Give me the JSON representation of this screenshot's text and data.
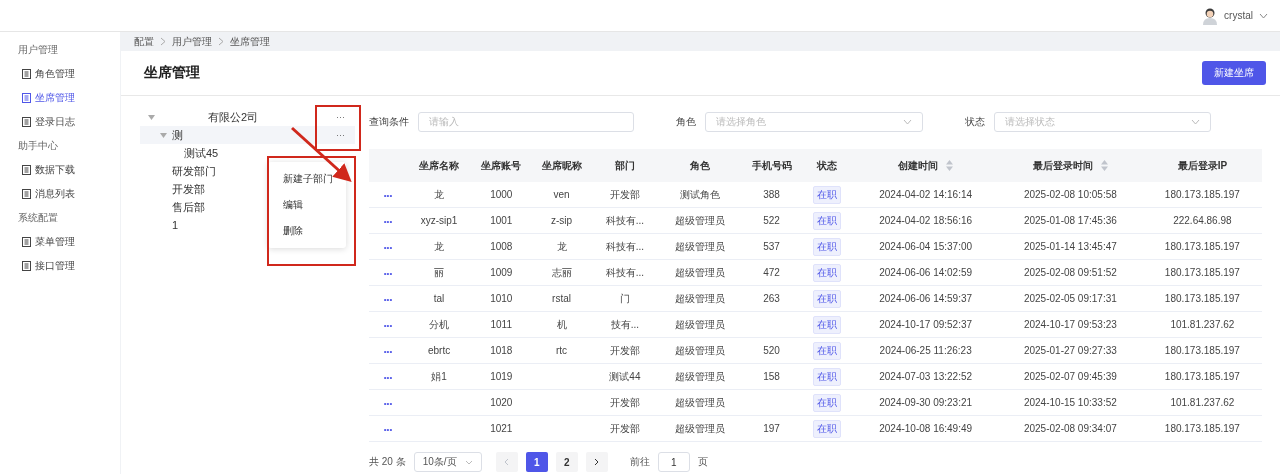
{
  "header": {
    "user": "crystal"
  },
  "sidebar": [
    {
      "group": "用户管理",
      "items": [
        {
          "label": "角色管理",
          "selected": false
        },
        {
          "label": "坐席管理",
          "selected": true
        },
        {
          "label": "登录日志",
          "selected": false
        }
      ]
    },
    {
      "group": "助手中心",
      "items": [
        {
          "label": "数据下载",
          "selected": false
        },
        {
          "label": "消息列表",
          "selected": false
        }
      ]
    },
    {
      "group": "系统配置",
      "items": [
        {
          "label": "菜单管理",
          "selected": false
        },
        {
          "label": "接口管理",
          "selected": false
        }
      ]
    }
  ],
  "breadcrumb": [
    "配置",
    "用户管理",
    "坐席管理"
  ],
  "page_title": "坐席管理",
  "new_button": "新建坐席",
  "tree": [
    {
      "label": "有限公2司",
      "expanded": true,
      "selected": false,
      "more": "···",
      "children": [
        {
          "label": "测",
          "expanded": true,
          "selected": true,
          "more": "···",
          "children": [
            {
              "label": "测试45",
              "selected": false
            }
          ]
        },
        {
          "label": "研发部门",
          "selected": false
        },
        {
          "label": "开发部",
          "selected": false
        },
        {
          "label": "售后部",
          "selected": false
        },
        {
          "label": "1",
          "selected": false
        }
      ]
    }
  ],
  "context_menu": [
    "新建子部门",
    "编辑",
    "删除"
  ],
  "filters": [
    {
      "label": "查询条件",
      "kind": "input",
      "placeholder": "请输入"
    },
    {
      "label": "角色",
      "kind": "select",
      "placeholder": "请选择角色"
    },
    {
      "label": "状态",
      "kind": "select",
      "placeholder": "请选择状态"
    }
  ],
  "table": {
    "columns": [
      {
        "label": "坐席名称",
        "sortable": false
      },
      {
        "label": "坐席账号",
        "sortable": false
      },
      {
        "label": "坐席昵称",
        "sortable": false
      },
      {
        "label": "部门",
        "sortable": false
      },
      {
        "label": "角色",
        "sortable": false
      },
      {
        "label": "手机号码",
        "sortable": false
      },
      {
        "label": "状态",
        "sortable": false
      },
      {
        "label": "创建时间",
        "sortable": true
      },
      {
        "label": "最后登录时间",
        "sortable": true
      },
      {
        "label": "最后登录IP",
        "sortable": false
      }
    ],
    "rows": [
      {
        "action": "•••",
        "cells": [
          "龙",
          "1000",
          "ven",
          "开发部",
          "测试角色",
          "388",
          "在职",
          "2024-04-02 14:16:14",
          "2025-02-08 10:05:58",
          "180.173.185.197"
        ]
      },
      {
        "action": "•••",
        "cells": [
          "xyz-sip1",
          "1001",
          "z-sip",
          "科技有...",
          "超级管理员",
          "522",
          "在职",
          "2024-04-02 18:56:16",
          "2025-01-08 17:45:36",
          "222.64.86.98"
        ]
      },
      {
        "action": "•••",
        "cells": [
          "龙",
          "1008",
          "龙",
          "科技有...",
          "超级管理员",
          "537",
          "在职",
          "2024-06-04 15:37:00",
          "2025-01-14 13:45:47",
          "180.173.185.197"
        ]
      },
      {
        "action": "•••",
        "cells": [
          "丽",
          "1009",
          "志丽",
          "科技有...",
          "超级管理员",
          "472",
          "在职",
          "2024-06-06 14:02:59",
          "2025-02-08 09:51:52",
          "180.173.185.197"
        ]
      },
      {
        "action": "•••",
        "cells": [
          "tal",
          "1010",
          "rstal",
          "门",
          "超级管理员",
          "263",
          "在职",
          "2024-06-06 14:59:37",
          "2025-02-05 09:17:31",
          "180.173.185.197"
        ]
      },
      {
        "action": "•••",
        "cells": [
          "分机",
          "1011",
          "机",
          "技有...",
          "超级管理员",
          null,
          "在职",
          "2024-10-17 09:52:37",
          "2024-10-17 09:53:23",
          "101.81.237.62"
        ]
      },
      {
        "action": "•••",
        "cells": [
          "ebrtc",
          "1018",
          "rtc",
          "开发部",
          "超级管理员",
          "520",
          "在职",
          "2024-06-25 11:26:23",
          "2025-01-27 09:27:33",
          "180.173.185.197"
        ]
      },
      {
        "action": "•••",
        "cells": [
          "娟1",
          "1019",
          null,
          "测试44",
          "超级管理员",
          "158",
          "在职",
          "2024-07-03 13:22:52",
          "2025-02-07 09:45:39",
          "180.173.185.197"
        ]
      },
      {
        "action": "•••",
        "cells": [
          null,
          "1020",
          null,
          "开发部",
          "超级管理员",
          null,
          "在职",
          "2024-09-30 09:23:21",
          "2024-10-15 10:33:52",
          "101.81.237.62"
        ]
      },
      {
        "action": "•••",
        "cells": [
          null,
          "1021",
          null,
          "开发部",
          "超级管理员",
          "197",
          "在职",
          "2024-10-08 16:49:49",
          "2025-02-08 09:34:07",
          "180.173.185.197"
        ]
      }
    ]
  },
  "pagination": {
    "total": "共 20 条",
    "page_size": "10条/页",
    "pages": [
      {
        "label": "1",
        "selected": true
      },
      {
        "label": "2",
        "selected": false
      }
    ],
    "prev_disabled": true,
    "goto_label": "前往",
    "goto_value": "1",
    "goto_suffix": "页"
  }
}
